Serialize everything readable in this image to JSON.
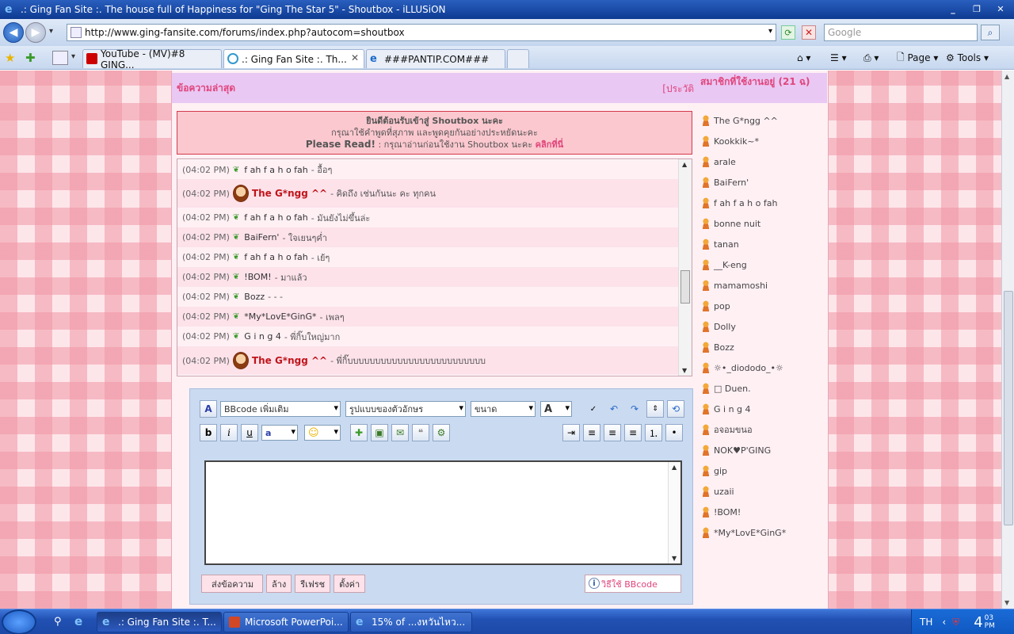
{
  "window": {
    "title": ".: Ging Fan Site :. The house full of Happiness for \"Ging The Star 5\" - Shoutbox - iLLUSiON",
    "minimize": "_",
    "maximize": "❐",
    "close": "✕"
  },
  "browser": {
    "url": "http://www.ging-fansite.com/forums/index.php?autocom=shoutbox",
    "search_placeholder": "Google",
    "tabs": [
      {
        "label": "YouTube - (MV)#8 GING...",
        "active": false
      },
      {
        "label": ".: Ging Fan Site :. Th...",
        "active": true
      },
      {
        "label": "###PANTIP.COM###",
        "active": false
      }
    ],
    "commands": {
      "page": "Page",
      "tools": "Tools"
    }
  },
  "shoutbox": {
    "header_title": "ข้อความล่าสุด",
    "history_label": "[ประวัติ",
    "welcome_line1": "ยินดีต้อนรับเข้าสู่ Shoutbox นะคะ",
    "welcome_line2": "กรุณาใช้คำพูดที่สุภาพ และพูดคุยกันอย่างประหยัดนะคะ",
    "welcome_bold": "Please Read!",
    "welcome_line3": " : กรุณาอ่านก่อนใช้งาน Shoutbox นะคะ ",
    "welcome_link": "คลิกที่นี่",
    "messages": [
      {
        "time": "(04:02 PM)",
        "user": "f ah f a h o fah",
        "text": "- อื้อๆ",
        "highlight": false
      },
      {
        "time": "(04:02 PM)",
        "user": "The G*ngg ^^",
        "text": "- คิดถึง เช่นกันนะ คะ ทุกคน",
        "highlight": true
      },
      {
        "time": "(04:02 PM)",
        "user": "f ah f a h o fah",
        "text": "- มันยังไม่ขึ้นล่ะ",
        "highlight": false
      },
      {
        "time": "(04:02 PM)",
        "user": "BaiFern'",
        "text": "- ใจเยนๆค่ำ",
        "highlight": false
      },
      {
        "time": "(04:02 PM)",
        "user": "f ah f a h o fah",
        "text": "- เย้ๆ",
        "highlight": false
      },
      {
        "time": "(04:02 PM)",
        "user": "!BOM!",
        "text": "- มาแล้ว",
        "highlight": false
      },
      {
        "time": "(04:02 PM)",
        "user": "Bozz",
        "text": "- - -",
        "highlight": false
      },
      {
        "time": "(04:02 PM)",
        "user": "*My*LovE*GinG*",
        "text": "- เพลๆ",
        "highlight": false
      },
      {
        "time": "(04:02 PM)",
        "user": "G i n g 4",
        "text": "- พี่กิ๊บใหญ่มาก",
        "highlight": false
      },
      {
        "time": "(04:02 PM)",
        "user": "The G*ngg ^^",
        "text": "- พี่กิ๊บบบบบบบบบบบบบบบบบบบบบบบบบ",
        "highlight": true
      }
    ]
  },
  "editor": {
    "bbcode_select": "BBcode เพิ่มเติม",
    "font_select": "รูปแบบของตัวอักษร",
    "size_select": "ขนาด",
    "color_select": "A",
    "bold": "b",
    "italic": "i",
    "underline": "u",
    "font_btn": "a",
    "send_button": "ส่งข้อความ",
    "clear_button": "ล้าง",
    "refresh_button": "รีเฟรช",
    "settings_button": "ตั้งค่า",
    "help_button": "วิธีใช้ BBcode"
  },
  "users_panel": {
    "title": "สมาชิกที่ใช้งานอยู่ (21 ฉ)",
    "users": [
      "The G*ngg ^^",
      "Kookkik~*",
      "arale",
      "BaiFern'",
      "f ah f a h o fah",
      "bonne nuit",
      "tanan",
      "__K-eng",
      "mamamoshi",
      "pop",
      "Dolly",
      "Bozz",
      "☼•_diododo_•☼",
      "□ Duen.",
      "G i n g 4",
      "อจอมขนอ",
      "NOK♥P'GING",
      "gip",
      "uzaii",
      "!BOM!",
      "*My*LovE*GinG*"
    ]
  },
  "taskbar": {
    "items": [
      {
        "label": ".: Ging Fan Site :. T...",
        "active": true
      },
      {
        "label": "Microsoft PowerPoi...",
        "active": false
      },
      {
        "label": "15% of ...งหวันไหว...",
        "active": false
      }
    ],
    "lang": "TH",
    "clock": "4",
    "clock_min": "03",
    "clock_ampm": "PM"
  },
  "colors": {
    "accent_pink": "#e0457b",
    "title_blue": "#0d3a91",
    "highlight_red": "#c0141b"
  }
}
